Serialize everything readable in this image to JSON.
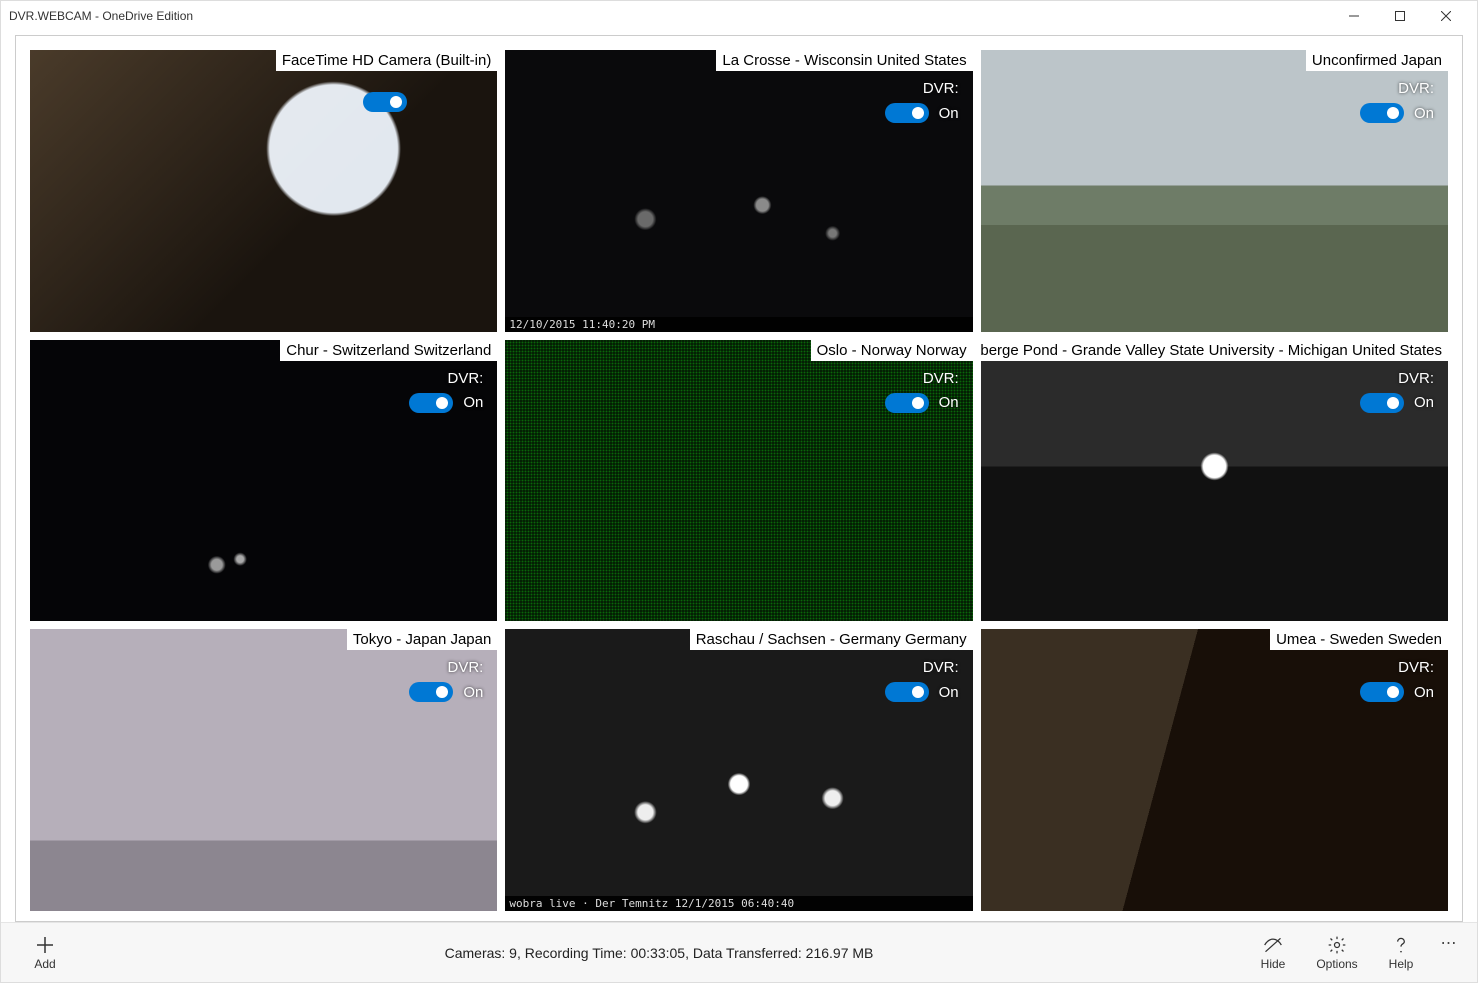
{
  "window": {
    "title": "DVR.WEBCAM - OneDrive Edition"
  },
  "status_text": "Cameras: 9, Recording Time: 00:33:05, Data Transferred: 216.97 MB",
  "dvr_label": "DVR:",
  "toggle_on_label": "On",
  "commands": {
    "add": "Add",
    "hide": "Hide",
    "options": "Options",
    "help": "Help"
  },
  "cameras": [
    {
      "title": "FaceTime HD Camera (Built-in)",
      "bg": "bg-room",
      "show_dvr_label": false,
      "timestamp": ""
    },
    {
      "title": "La Crosse - Wisconsin United States",
      "bg": "bg-night1",
      "show_dvr_label": true,
      "timestamp": "12/10/2015 11:40:20 PM"
    },
    {
      "title": "Unconfirmed Japan",
      "bg": "bg-hills",
      "show_dvr_label": true,
      "timestamp": ""
    },
    {
      "title": "Chur - Switzerland Switzerland",
      "bg": "bg-night2",
      "show_dvr_label": true,
      "timestamp": ""
    },
    {
      "title": "Oslo - Norway Norway",
      "bg": "bg-green",
      "show_dvr_label": true,
      "timestamp": ""
    },
    {
      "title": "Zumberge Pond - Grande Valley State University - Michigan United States",
      "bg": "bg-pond",
      "show_dvr_label": true,
      "timestamp": ""
    },
    {
      "title": "Tokyo - Japan Japan",
      "bg": "bg-fog",
      "show_dvr_label": true,
      "timestamp": ""
    },
    {
      "title": "Raschau / Sachsen - Germany Germany",
      "bg": "bg-city",
      "show_dvr_label": true,
      "timestamp": "wobra live · Der Temnitz 12/1/2015 06:40:40"
    },
    {
      "title": "Umea - Sweden Sweden",
      "bg": "bg-street",
      "show_dvr_label": true,
      "timestamp": ""
    }
  ]
}
